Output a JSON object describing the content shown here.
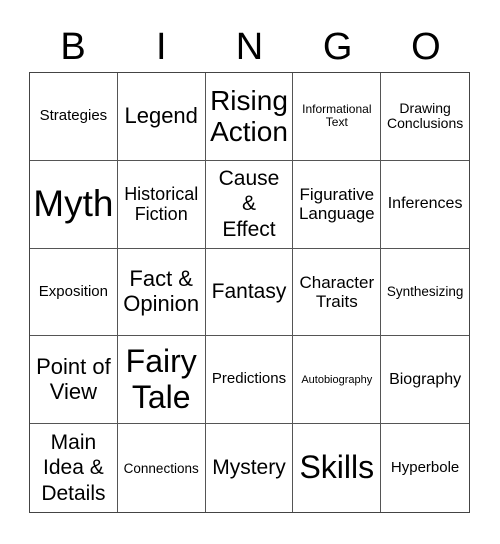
{
  "header": {
    "letters": [
      "B",
      "I",
      "N",
      "G",
      "O"
    ]
  },
  "board": {
    "cells": [
      "Strategies",
      "Legend",
      "Rising Action",
      "Informational Text",
      "Drawing Conclusions",
      "Myth",
      "Historical Fiction",
      "Cause & Effect",
      "Figurative Language",
      "Inferences",
      "Exposition",
      "Fact & Opinion",
      "Fantasy",
      "Character Traits",
      "Synthesizing",
      "Point of View",
      "Fairy Tale",
      "Predictions",
      "Autobiography",
      "Biography",
      "Main Idea & Details",
      "Connections",
      "Mystery",
      "Skills",
      "Hyperbole"
    ]
  }
}
